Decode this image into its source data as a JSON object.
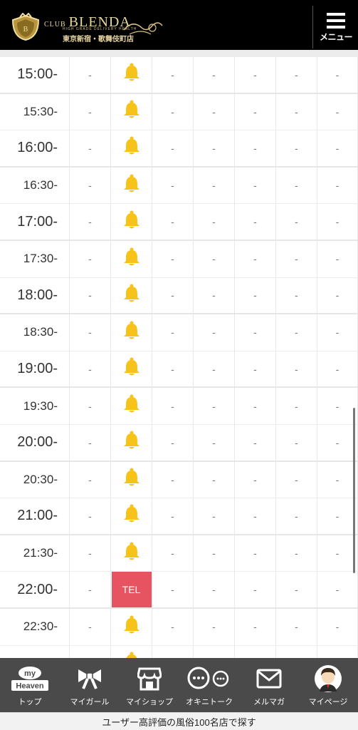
{
  "header": {
    "logo_club": "CLUB",
    "logo_name": "BLENDA",
    "logo_sub": "HIGH GRADE DELIVERY HEALTH",
    "logo_area": "東京新宿・歌舞伎町店",
    "menu_label": "メニュー"
  },
  "schedule": {
    "rows": [
      {
        "time": "15:00-",
        "kind": "hour",
        "cells": [
          "-",
          "bell",
          "-",
          "-",
          "-",
          "-",
          "-"
        ]
      },
      {
        "time": "15:30-",
        "kind": "half",
        "cells": [
          "-",
          "bell",
          "-",
          "-",
          "-",
          "-",
          "-"
        ]
      },
      {
        "time": "16:00-",
        "kind": "hour",
        "cells": [
          "-",
          "bell",
          "-",
          "-",
          "-",
          "-",
          "-"
        ]
      },
      {
        "time": "16:30-",
        "kind": "half",
        "cells": [
          "-",
          "bell",
          "-",
          "-",
          "-",
          "-",
          "-"
        ]
      },
      {
        "time": "17:00-",
        "kind": "hour",
        "cells": [
          "-",
          "bell",
          "-",
          "-",
          "-",
          "-",
          "-"
        ]
      },
      {
        "time": "17:30-",
        "kind": "half",
        "cells": [
          "-",
          "bell",
          "-",
          "-",
          "-",
          "-",
          "-"
        ]
      },
      {
        "time": "18:00-",
        "kind": "hour",
        "cells": [
          "-",
          "bell",
          "-",
          "-",
          "-",
          "-",
          "-"
        ]
      },
      {
        "time": "18:30-",
        "kind": "half",
        "cells": [
          "-",
          "bell",
          "-",
          "-",
          "-",
          "-",
          "-"
        ]
      },
      {
        "time": "19:00-",
        "kind": "hour",
        "cells": [
          "-",
          "bell",
          "-",
          "-",
          "-",
          "-",
          "-"
        ]
      },
      {
        "time": "19:30-",
        "kind": "half",
        "cells": [
          "-",
          "bell",
          "-",
          "-",
          "-",
          "-",
          "-"
        ]
      },
      {
        "time": "20:00-",
        "kind": "hour",
        "cells": [
          "-",
          "bell",
          "-",
          "-",
          "-",
          "-",
          "-"
        ]
      },
      {
        "time": "20:30-",
        "kind": "half",
        "cells": [
          "-",
          "bell",
          "-",
          "-",
          "-",
          "-",
          "-"
        ]
      },
      {
        "time": "21:00-",
        "kind": "hour",
        "cells": [
          "-",
          "bell",
          "-",
          "-",
          "-",
          "-",
          "-"
        ]
      },
      {
        "time": "21:30-",
        "kind": "half",
        "cells": [
          "-",
          "bell",
          "-",
          "-",
          "-",
          "-",
          "-"
        ]
      },
      {
        "time": "22:00-",
        "kind": "hour",
        "cells": [
          "-",
          "TEL",
          "-",
          "-",
          "-",
          "-",
          "-"
        ]
      },
      {
        "time": "22:30-",
        "kind": "half",
        "cells": [
          "-",
          "bell",
          "-",
          "-",
          "-",
          "-",
          "-"
        ]
      },
      {
        "time": "",
        "kind": "hour",
        "cells": [
          "",
          "bell",
          "",
          "",
          "",
          "",
          ""
        ]
      }
    ],
    "colors": {
      "bell": "#f7c31b",
      "tel": "#e65461"
    },
    "bell_icon": "bell-icon"
  },
  "footer": {
    "nav": [
      {
        "label": "トップ",
        "icon": "my-heaven-logo-icon",
        "logo_top": "my",
        "logo_bottom": "Heaven"
      },
      {
        "label": "マイガール",
        "icon": "ribbon-icon"
      },
      {
        "label": "マイショップ",
        "icon": "shop-icon"
      },
      {
        "label": "オキニトーク",
        "icon": "chat-bubbles-icon"
      },
      {
        "label": "メルマガ",
        "icon": "mail-icon"
      },
      {
        "label": "マイページ",
        "icon": "avatar-icon"
      }
    ],
    "bottom_banner": "ユーザー高評価の風俗100名店で探す"
  }
}
